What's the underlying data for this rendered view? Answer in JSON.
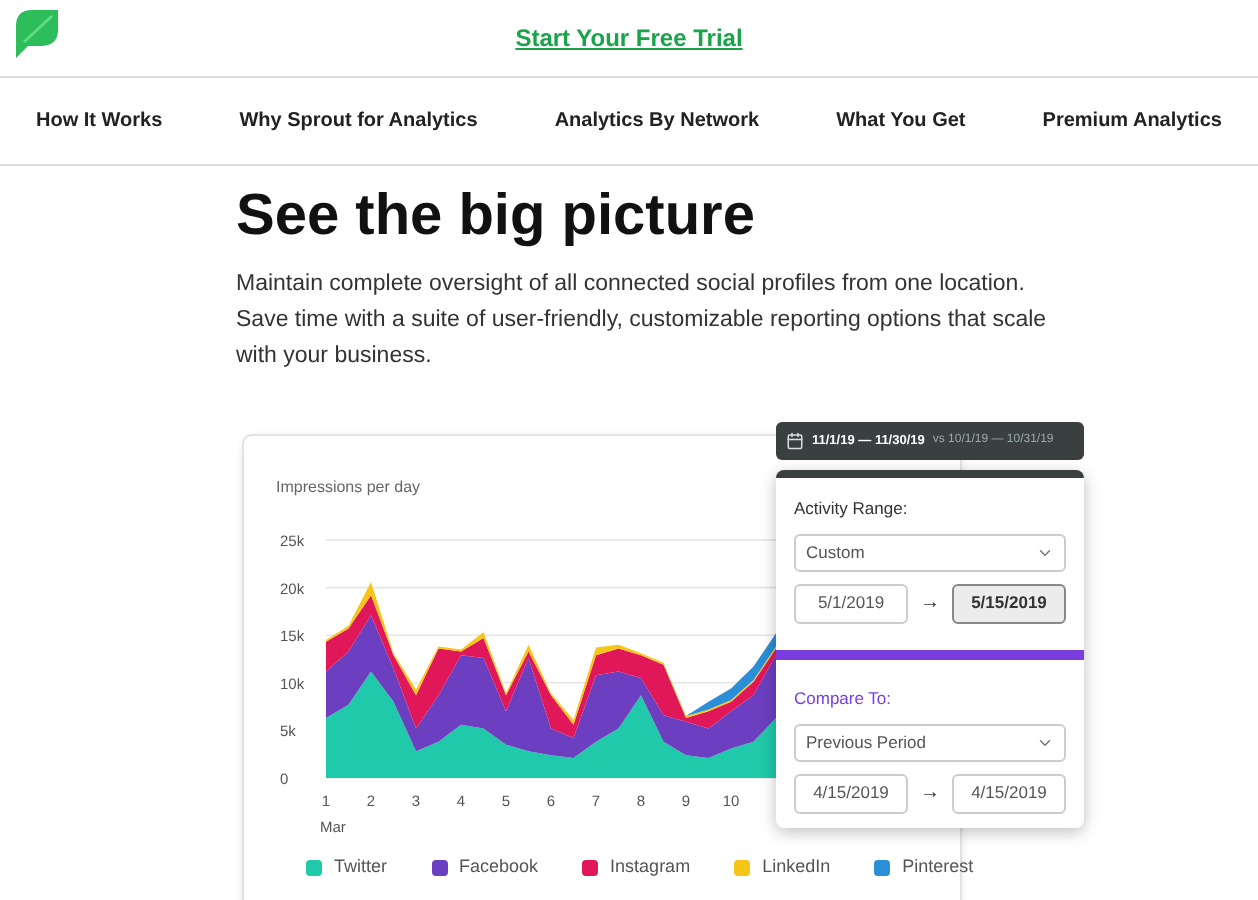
{
  "header": {
    "trial_link": "Start Your Free Trial"
  },
  "nav": [
    "How It Works",
    "Why Sprout for Analytics",
    "Analytics By Network",
    "What You Get",
    "Premium Analytics"
  ],
  "hero": {
    "title": "See the big picture",
    "text": "Maintain complete oversight of all connected social profiles from one location. Save time with a suite of user-friendly, customizable reporting options that scale with your business."
  },
  "chart": {
    "chart_data": {
      "type": "area",
      "stacked": true,
      "title": "Impressions per day",
      "xlabel": "Mar",
      "x": [
        1,
        1.5,
        2,
        2.5,
        3,
        3.5,
        4,
        4.5,
        5,
        5.5,
        6,
        6.5,
        7,
        7.5,
        8,
        8.5,
        9,
        9.5,
        10,
        10.5,
        11
      ],
      "xticks": [
        1,
        2,
        3,
        4,
        5,
        6,
        7,
        8,
        9,
        10
      ],
      "xlim": [
        1,
        11
      ],
      "grid": true,
      "legend": true,
      "ylim": [
        0,
        25
      ],
      "yticks": [
        {
          "value": 0,
          "label": "0"
        },
        {
          "value": 5,
          "label": "5k"
        },
        {
          "value": 10,
          "label": "10k"
        },
        {
          "value": 15,
          "label": "15k"
        },
        {
          "value": 20,
          "label": "20k"
        },
        {
          "value": 25,
          "label": "25k"
        }
      ],
      "series": [
        {
          "name": "Twitter",
          "color": "#1fc9a9",
          "values": [
            6.3,
            7.7,
            11.2,
            8,
            2.8,
            3.8,
            5.6,
            5.2,
            3.5,
            2.8,
            2.4,
            2.1,
            3.8,
            5.2,
            8.7,
            3.8,
            2.4,
            2.1,
            3.1,
            3.8,
            6.3
          ]
        },
        {
          "name": "Facebook",
          "color": "#6b3fbf",
          "values": [
            4.9,
            5.6,
            5.9,
            3.5,
            2.4,
            4.9,
            7.3,
            7.4,
            3.5,
            9.8,
            2.8,
            2.1,
            7,
            6,
            1.8,
            2.8,
            3.5,
            3.1,
            3.9,
            4.9,
            6.6
          ]
        },
        {
          "name": "Instagram",
          "color": "#e0185a",
          "values": [
            3.1,
            2.4,
            2.1,
            1.4,
            3.5,
            4.9,
            0.4,
            2.1,
            1.7,
            0.7,
            3.5,
            1.4,
            2.1,
            2.4,
            2.4,
            5.3,
            0.4,
            1.8,
            1,
            1.4,
            0.7
          ]
        },
        {
          "name": "LinkedIn",
          "color": "#f5c518",
          "values": [
            0.2,
            0.3,
            1.4,
            0.2,
            0.6,
            0.2,
            0.2,
            0.6,
            0.2,
            0.7,
            0.2,
            0.5,
            0.8,
            0.4,
            0.2,
            0.2,
            0.2,
            0.2,
            0.2,
            0.2,
            0.2
          ]
        },
        {
          "name": "Pinterest",
          "color": "#2a8fd6",
          "values": [
            0,
            0,
            0,
            0,
            0,
            0,
            0,
            0,
            0,
            0,
            0,
            0,
            0,
            0,
            0,
            0,
            0,
            0.8,
            1.2,
            1.4,
            1.4
          ]
        }
      ]
    }
  },
  "date_picker": {
    "range": "11/1/19 — 11/30/19",
    "compare_range": "vs 10/1/19 — 10/31/19",
    "activity_label": "Activity Range:",
    "activity_select": "Custom",
    "activity_dates": [
      {
        "value": "5/1/2019",
        "selected": false
      },
      {
        "value": "5/15/2019",
        "selected": true
      }
    ],
    "compare_label": "Compare To:",
    "compare_select": "Previous Period",
    "compare_dates": [
      {
        "value": "4/15/2019",
        "selected": false
      },
      {
        "value": "4/15/2019",
        "selected": false
      }
    ],
    "arrow": "→"
  }
}
